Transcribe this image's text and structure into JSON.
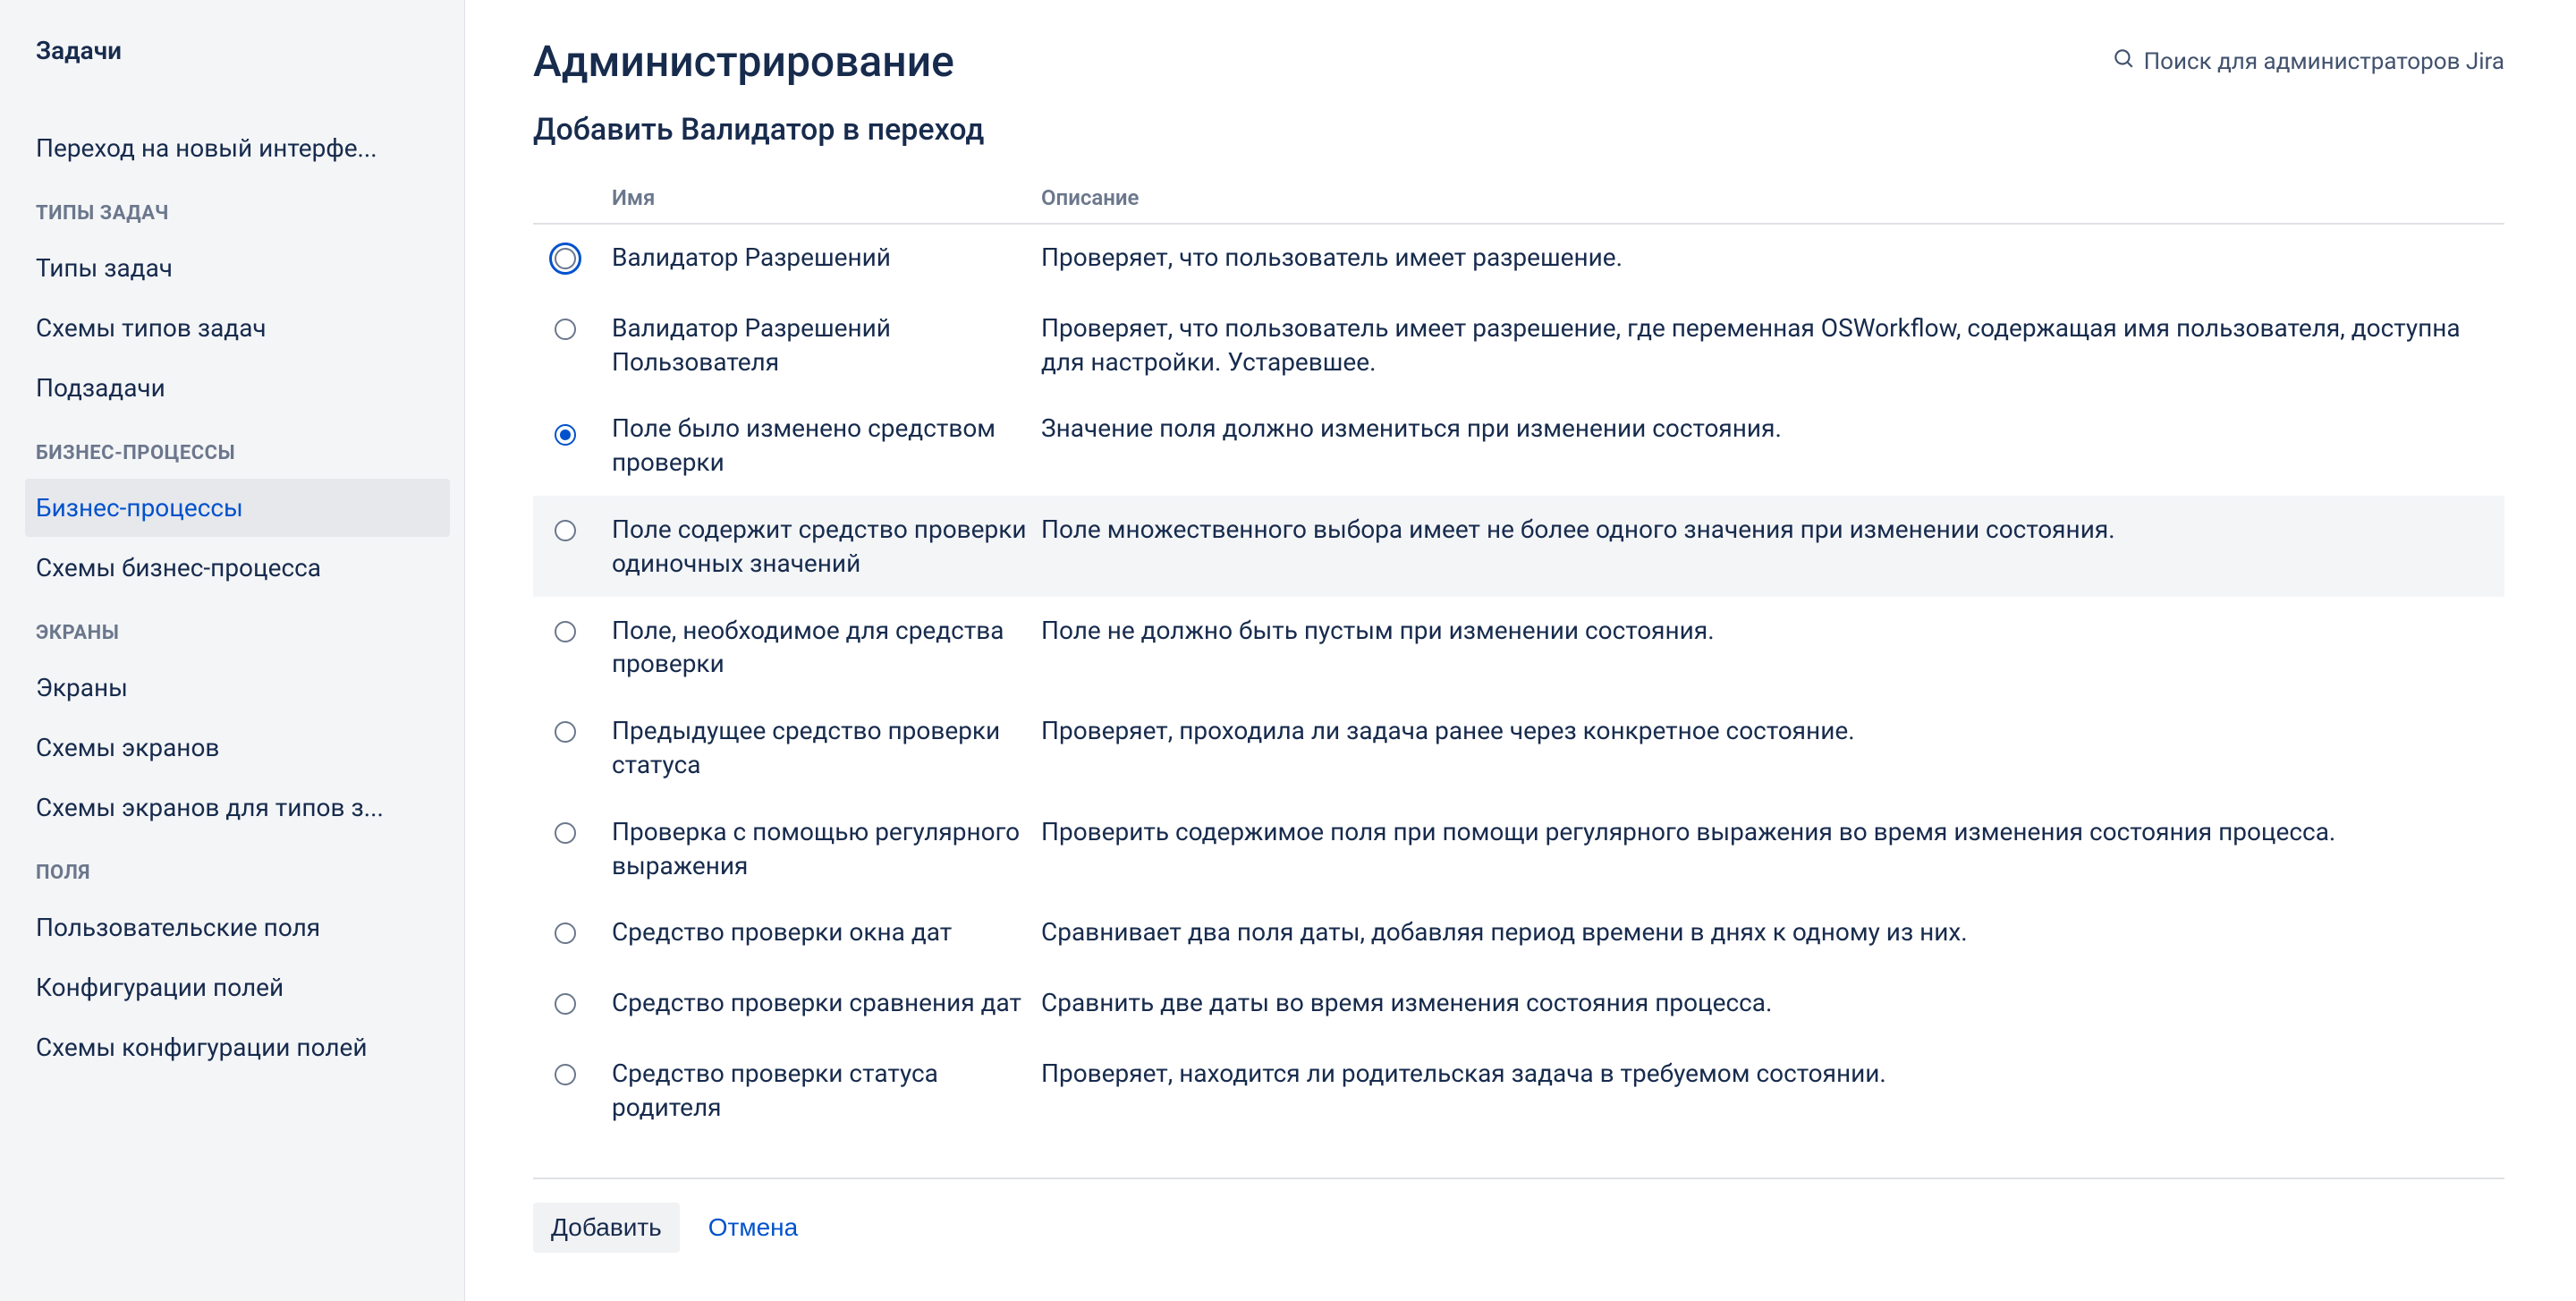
{
  "sidebar": {
    "title": "Задачи",
    "toplink": "Переход на новый интерфе...",
    "sections": [
      {
        "label": "ТИПЫ ЗАДАЧ",
        "items": [
          "Типы задач",
          "Схемы типов задач",
          "Подзадачи"
        ]
      },
      {
        "label": "БИЗНЕС-ПРОЦЕССЫ",
        "items": [
          "Бизнес-процессы",
          "Схемы бизнес-процесса"
        ]
      },
      {
        "label": "ЭКРАНЫ",
        "items": [
          "Экраны",
          "Схемы экранов",
          "Схемы экранов для типов з..."
        ]
      },
      {
        "label": "ПОЛЯ",
        "items": [
          "Пользовательские поля",
          "Конфигурации полей",
          "Схемы конфигурации полей"
        ]
      }
    ],
    "active": "Бизнес-процессы"
  },
  "header": {
    "title": "Администрирование",
    "search_label": "Поиск для администраторов Jira"
  },
  "main": {
    "subheading": "Добавить Валидатор в переход",
    "columns": {
      "name": "Имя",
      "description": "Описание"
    },
    "selected_index": 2,
    "focused_index": 0,
    "hover_index": 3,
    "validators": [
      {
        "name": "Валидатор Разрешений",
        "description": "Проверяет, что пользователь имеет разрешение."
      },
      {
        "name": "Валидатор Разрешений Пользователя",
        "description": "Проверяет, что пользователь имеет разрешение, где переменная OSWorkflow, содержащая имя пользователя, доступна для настройки. Устаревшее."
      },
      {
        "name": "Поле было изменено средством проверки",
        "description": "Значение поля должно измениться при изменении состояния."
      },
      {
        "name": "Поле содержит средство проверки одиночных значений",
        "description": "Поле множественного выбора имеет не более одного значения при изменении состояния."
      },
      {
        "name": "Поле, необходимое для средства проверки",
        "description": "Поле не должно быть пустым при изменении состояния."
      },
      {
        "name": "Предыдущее средство проверки статуса",
        "description": "Проверяет, проходила ли задача ранее через конкретное состояние."
      },
      {
        "name": "Проверка с помощью регулярного выражения",
        "description": "Проверить содержимое поля при помощи регулярного выражения во время изменения состояния процесса."
      },
      {
        "name": "Средство проверки окна дат",
        "description": "Сравнивает два поля даты, добавляя период времени в днях к одному из них."
      },
      {
        "name": "Средство проверки сравнения дат",
        "description": "Сравнить две даты во время изменения состояния процесса."
      },
      {
        "name": "Средство проверки статуса родителя",
        "description": "Проверяет, находится ли родительская задача в требуемом состоянии."
      }
    ],
    "buttons": {
      "add": "Добавить",
      "cancel": "Отмена"
    }
  }
}
